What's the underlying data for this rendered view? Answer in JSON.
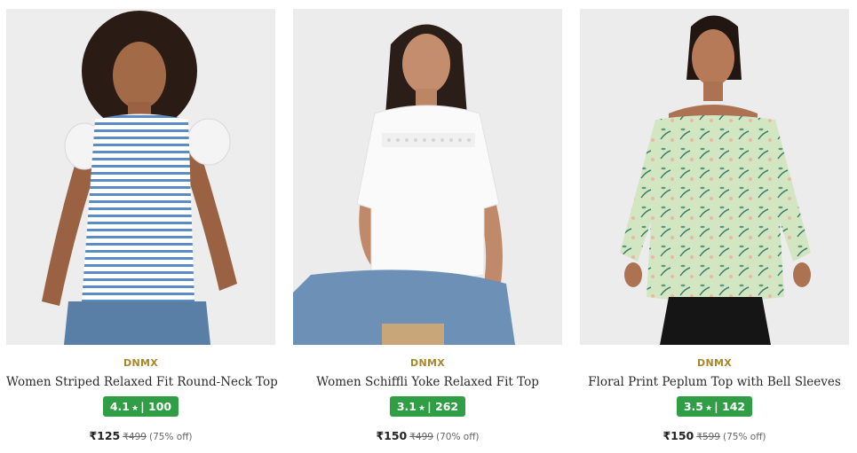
{
  "products": [
    {
      "brand": "DNMX",
      "title": "Women Striped Relaxed Fit Round-Neck Top",
      "rating": "4.1",
      "rating_count": "100",
      "price": "₹125",
      "mrp": "₹499",
      "discount": "(75% off)",
      "image_alt": "Woman wearing blue striped top with ruffle sleeves"
    },
    {
      "brand": "DNMX",
      "title": "Women Schiffli Yoke Relaxed Fit Top",
      "rating": "3.1",
      "rating_count": "262",
      "price": "₹150",
      "mrp": "₹499",
      "discount": "(70% off)",
      "image_alt": "Woman wearing white top with lace yoke"
    },
    {
      "brand": "DNMX",
      "title": "Floral Print Peplum Top with Bell Sleeves",
      "rating": "3.5",
      "rating_count": "142",
      "price": "₹150",
      "mrp": "₹599",
      "discount": "(75% off)",
      "image_alt": "Woman wearing green floral off-shoulder peplum top"
    }
  ],
  "rating_star": "★",
  "rating_separator": "|",
  "colors": {
    "brand": "#a8862a",
    "rating_bg": "#2f9e44",
    "card_bg": "#eeeeee"
  }
}
